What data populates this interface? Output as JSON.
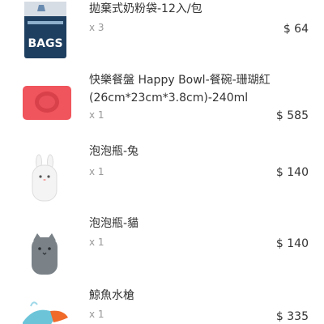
{
  "cart": {
    "items": [
      {
        "name": "拋棄式奶粉袋-12入/包",
        "qty": "x 3",
        "price": "$ 64",
        "bag_text": "BAGS"
      },
      {
        "name": "快樂餐盤 Happy Bowl-餐碗-珊瑚紅\n(26cm*23cm*3.8cm)-240ml",
        "qty": "x 1",
        "price": "$ 585"
      },
      {
        "name": "泡泡瓶-兔",
        "qty": "x 1",
        "price": "$ 140"
      },
      {
        "name": "泡泡瓶-貓",
        "qty": "x 1",
        "price": "$ 140"
      },
      {
        "name": "鯨魚水槍",
        "qty": "x 1",
        "price": "$ 335"
      }
    ]
  },
  "colors": {
    "text": "#333333",
    "muted": "#999999",
    "coral": "#f0545c",
    "bottle_white": "#f4f4f4",
    "bottle_gray": "#7a8288",
    "whale_blue": "#6cc4d9",
    "whale_orange": "#f06a2a"
  }
}
